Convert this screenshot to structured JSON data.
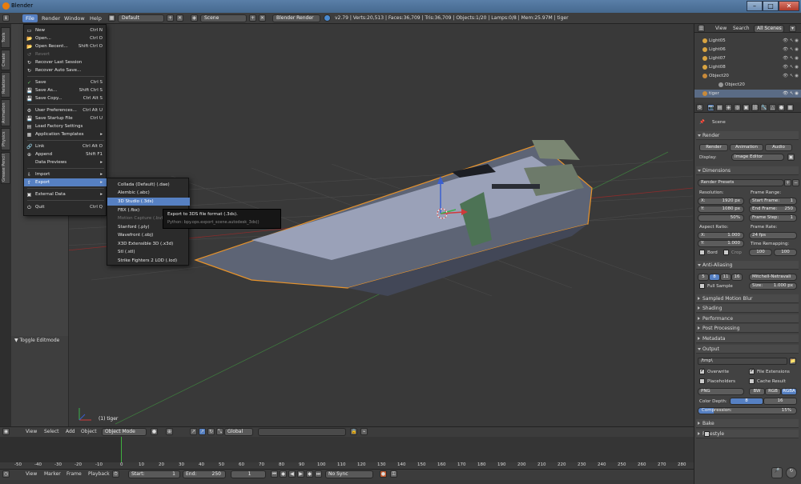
{
  "window": {
    "title": "Blender",
    "minimize": "–",
    "maximize": "□",
    "close": "✕"
  },
  "topmenu": {
    "file": "File",
    "render": "Render",
    "window": "Window",
    "help": "Help",
    "layout": "Default",
    "scene": "Scene",
    "engine": "Blender Render",
    "stats": "v2.79 | Verts:20,513 | Faces:36,709 | Tris:36,709 | Objects:1/20 | Lamps:0/8 | Mem:25.97M | tiger"
  },
  "lefttabs": [
    "Tools",
    "Create",
    "Relations",
    "Animation",
    "Physics",
    "Grease Pencil"
  ],
  "file_menu": [
    {
      "label": "New",
      "shortcut": "Ctrl N",
      "icon": "new-file-icon"
    },
    {
      "label": "Open...",
      "shortcut": "Ctrl O",
      "icon": "folder-icon"
    },
    {
      "label": "Open Recent...",
      "shortcut": "Shift Ctrl O",
      "icon": "folder-icon"
    },
    {
      "label": "Revert",
      "shortcut": "",
      "icon": "revert-icon",
      "disabled": true
    },
    {
      "label": "Recover Last Session",
      "shortcut": "",
      "icon": "recover-icon"
    },
    {
      "label": "Recover Auto Save...",
      "shortcut": "",
      "icon": "recover-icon"
    },
    {
      "label": "Save",
      "shortcut": "Ctrl S",
      "icon": "save-icon"
    },
    {
      "label": "Save As...",
      "shortcut": "Shift Ctrl S",
      "icon": "save-icon"
    },
    {
      "label": "Save Copy...",
      "shortcut": "Ctrl Alt S",
      "icon": "save-icon"
    },
    {
      "label": "User Preferences...",
      "shortcut": "Ctrl Alt U",
      "icon": "prefs-icon"
    },
    {
      "label": "Save Startup File",
      "shortcut": "Ctrl U",
      "icon": "save-icon"
    },
    {
      "label": "Load Factory Settings",
      "shortcut": "",
      "icon": "load-icon"
    },
    {
      "label": "Application Templates",
      "shortcut": "▸",
      "icon": "template-icon"
    },
    {
      "label": "Link",
      "shortcut": "Ctrl Alt O",
      "icon": "link-icon"
    },
    {
      "label": "Append",
      "shortcut": "Shift F1",
      "icon": "append-icon"
    },
    {
      "label": "Data Previews",
      "shortcut": "▸",
      "icon": ""
    },
    {
      "label": "Import",
      "shortcut": "▸",
      "icon": "import-icon"
    },
    {
      "label": "Export",
      "shortcut": "▸",
      "icon": "export-icon"
    },
    {
      "label": "External Data",
      "shortcut": "▸",
      "icon": "external-icon"
    },
    {
      "label": "Quit",
      "shortcut": "Ctrl Q",
      "icon": "quit-icon"
    }
  ],
  "export_menu": [
    "Collada (Default) (.dae)",
    "Alembic (.abc)",
    "3D Studio (.3ds)",
    "FBX (.fbx)",
    "Motion Capture (.bvh)",
    "Stanford (.ply)",
    "Wavefront (.obj)",
    "X3D Extensible 3D (.x3d)",
    "Stl (.stl)",
    "Strike Fighters 2 LOD (.lod)"
  ],
  "tooltip": {
    "title": "Export to 3DS file format (.3ds).",
    "python": "Python: bpy.ops.export_scene.autodesk_3ds()"
  },
  "viewport": {
    "toggle_editmode": "▼ Toggle Editmode",
    "object_label": "(1) tiger"
  },
  "vp_header": {
    "view": "View",
    "select": "Select",
    "add": "Add",
    "object": "Object",
    "mode": "Object Mode",
    "orientation": "Global"
  },
  "timeline": {
    "ticks": [
      "-50",
      "-40",
      "-30",
      "-20",
      "-10",
      "0",
      "10",
      "20",
      "30",
      "40",
      "50",
      "60",
      "70",
      "80",
      "90",
      "100",
      "110",
      "120",
      "130",
      "140",
      "150",
      "160",
      "170",
      "180",
      "190",
      "200",
      "210",
      "220",
      "230",
      "240",
      "250",
      "260",
      "270",
      "280"
    ],
    "view": "View",
    "marker": "Marker",
    "frame": "Frame",
    "playback": "Playback",
    "start_label": "Start:",
    "start": "1",
    "end_label": "End:",
    "end": "250",
    "current": "1",
    "sync": "No Sync"
  },
  "outliner": {
    "view": "View",
    "search": "Search",
    "all_scenes": "All Scenes",
    "rows": [
      "Light05",
      "Light06",
      "Light07",
      "Light08",
      "Object20",
      "Object20",
      "tiger"
    ]
  },
  "properties": {
    "scene": "Scene",
    "render_label": "Render",
    "render_btn": "Render",
    "animation_btn": "Animation",
    "audio_btn": "Audio",
    "display_label": "Display:",
    "display": "Image Editor",
    "dimensions": "Dimensions",
    "presets": "Render Presets",
    "resolution": "Resolution:",
    "res_x_label": "X:",
    "res_x": "1920 px",
    "res_y_label": "Y:",
    "res_y": "1080 px",
    "res_pct": "50%",
    "frame_range": "Frame Range:",
    "start_frame_label": "Start Frame:",
    "start_frame": "1",
    "end_frame_label": "End Frame:",
    "end_frame": "250",
    "frame_step_label": "Frame Step:",
    "frame_step": "1",
    "aspect": "Aspect Ratio:",
    "asp_x": "1.000",
    "asp_y": "1.000",
    "frame_rate": "Frame Rate:",
    "fps": "24 fps",
    "time_remap": "Time Remapping:",
    "remap_old": "100",
    "remap_new": "100",
    "border": "Bord",
    "crop": "Crop",
    "aa": "Anti-Aliasing",
    "aa_5": "5",
    "aa_8": "8",
    "aa_11": "11",
    "aa_16": "16",
    "filter": "Mitchell-Netravali",
    "full_sample": "Full Sample",
    "size_label": "Size:",
    "size": "1.000 px",
    "sampled_blur": "Sampled Motion Blur",
    "shading": "Shading",
    "performance": "Performance",
    "post": "Post Processing",
    "metadata": "Metadata",
    "output": "Output",
    "path": "/tmp\\",
    "overwrite": "Overwrite",
    "file_ext": "File Extensions",
    "placeholders": "Placeholders",
    "cache": "Cache Result",
    "format": "PNG",
    "bw": "BW",
    "rgb": "RGB",
    "rgba": "RGBA",
    "depth_label": "Color Depth:",
    "depth_8": "8",
    "depth_16": "16",
    "compression_label": "Compression:",
    "compression": "15%",
    "bake": "Bake",
    "freestyle": "Freestyle"
  }
}
